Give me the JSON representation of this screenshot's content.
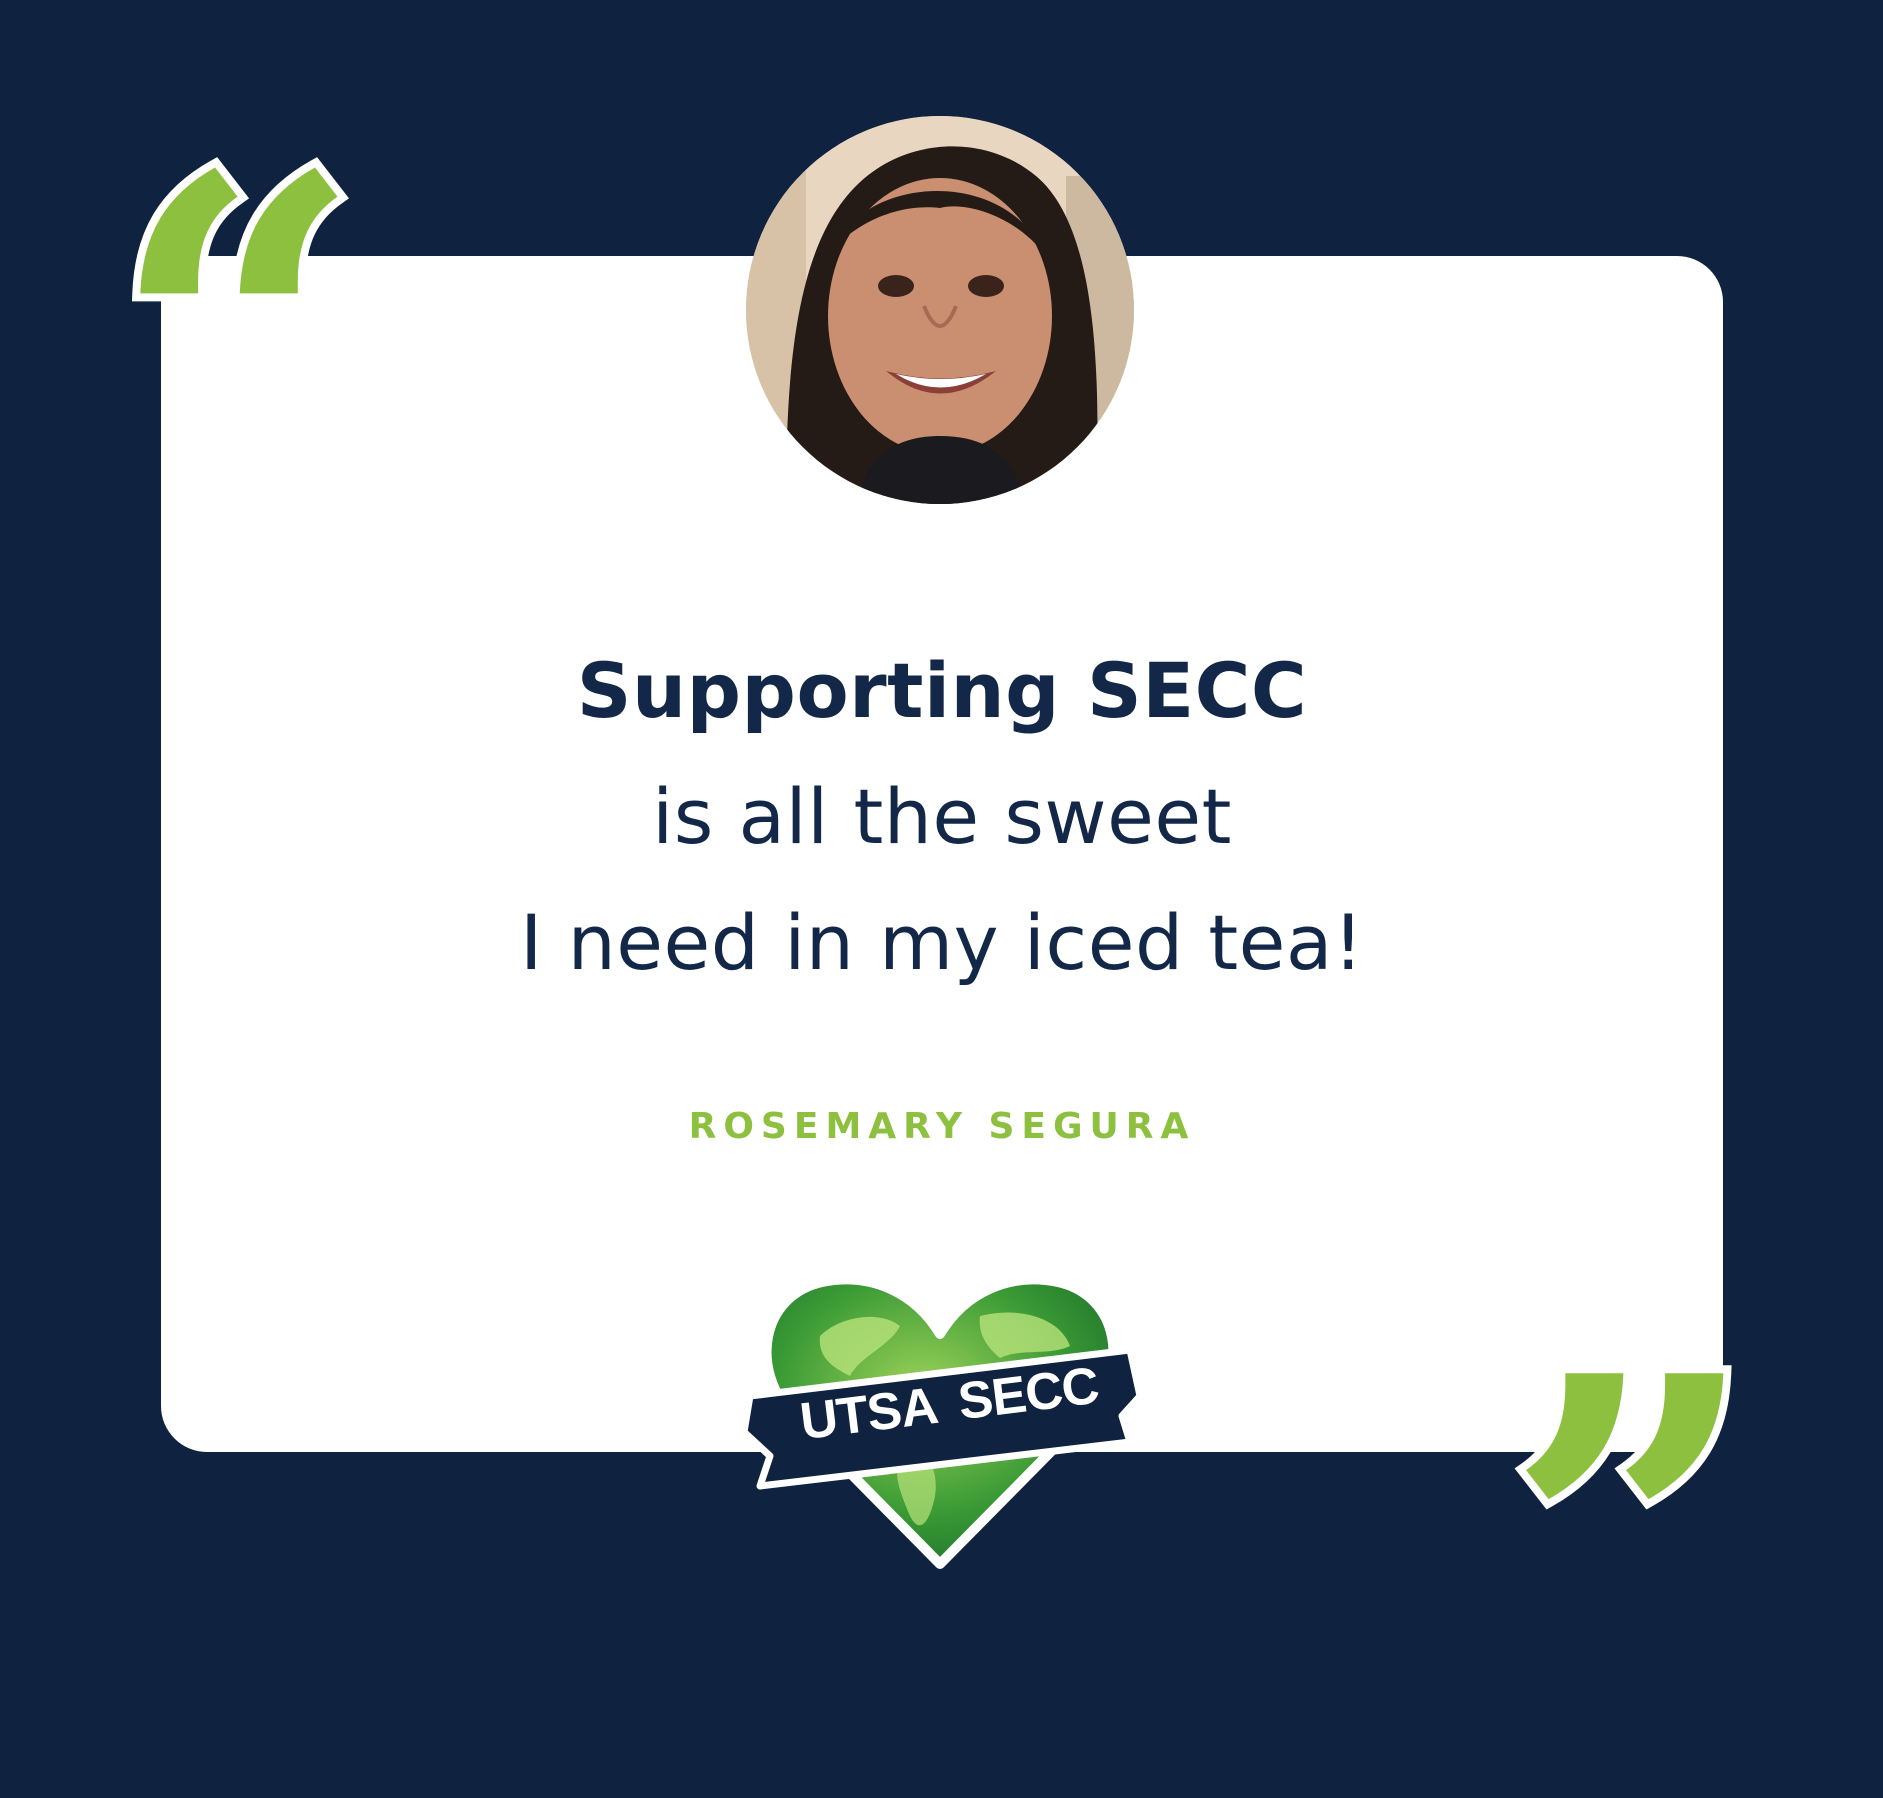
{
  "quote": {
    "lines": [
      "Supporting SECC",
      "is all the sweet",
      "I need in my iced tea!"
    ],
    "author": "ROSEMARY SEGURA"
  },
  "logo": {
    "left_word": "UTSA",
    "right_word": "SECC"
  },
  "colors": {
    "background": "#0f2240",
    "card": "#ffffff",
    "accent": "#8dc03f",
    "text": "#132848"
  },
  "icons": {
    "open_quote": "left-double-quote-icon",
    "close_quote": "right-double-quote-icon"
  }
}
